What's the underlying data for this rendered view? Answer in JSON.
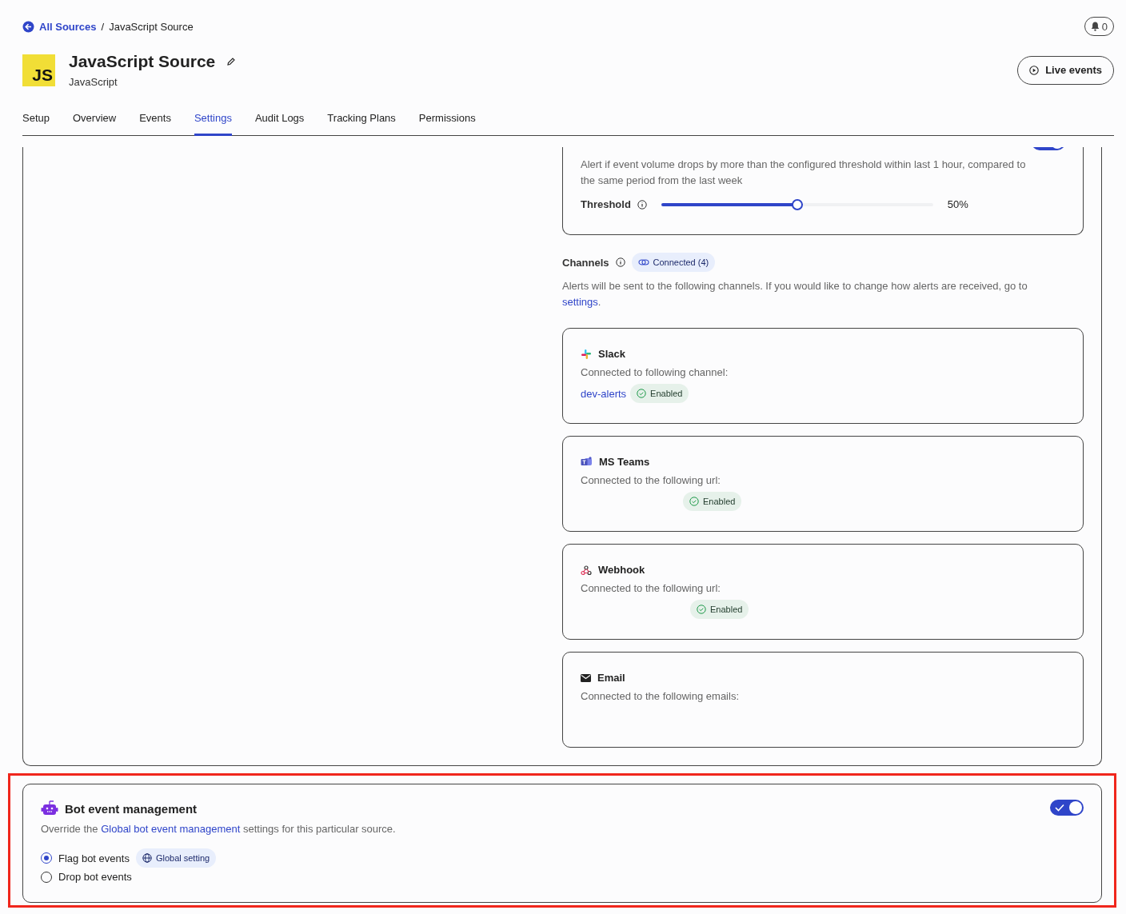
{
  "breadcrumb": {
    "link": "All Sources",
    "separator": "/",
    "current": "JavaScript Source"
  },
  "notifications": {
    "count": "0"
  },
  "source": {
    "logo": "JS",
    "title": "JavaScript Source",
    "subtitle": "JavaScript"
  },
  "live_button": {
    "label": "Live events"
  },
  "tabs": [
    {
      "label": "Setup",
      "selected": false
    },
    {
      "label": "Overview",
      "selected": false
    },
    {
      "label": "Events",
      "selected": false
    },
    {
      "label": "Settings",
      "selected": true
    },
    {
      "label": "Audit Logs",
      "selected": false
    },
    {
      "label": "Tracking Plans",
      "selected": false
    },
    {
      "label": "Permissions",
      "selected": false
    }
  ],
  "alert_card": {
    "on": true,
    "description": "Alert if event volume drops by more than the configured threshold within last 1 hour, compared to the same period from the last week",
    "threshold": {
      "label": "Threshold",
      "level": 0.5,
      "reading": "50%"
    }
  },
  "channels": {
    "label": "Channels",
    "badge": "Connected (4)",
    "description": "Alerts will be sent to the following channels. If you would like to change how alerts are received, go to",
    "link": "settings",
    "after_link": "."
  },
  "channel_cards": [
    {
      "kind": "slack",
      "name": "Slack",
      "caption": "Connected to following channel:",
      "link": "dev-alerts",
      "status": "Enabled"
    },
    {
      "kind": "teams",
      "name": "MS Teams",
      "caption": "Connected to the following url:",
      "status": "Enabled"
    },
    {
      "kind": "webhook",
      "name": "Webhook",
      "caption": "Connected to the following url:",
      "status": "Enabled"
    },
    {
      "kind": "email",
      "name": "Email",
      "caption": "Connected to the following emails:"
    }
  ],
  "bot": {
    "title": "Bot event management",
    "on": true,
    "before_link": "Override the",
    "link": "Global bot event management",
    "after_link": "settings for this particular source.",
    "options": [
      {
        "label": "Flag bot events",
        "selected": true,
        "badge": "Global setting"
      },
      {
        "label": "Drop bot events",
        "selected": false
      }
    ]
  }
}
